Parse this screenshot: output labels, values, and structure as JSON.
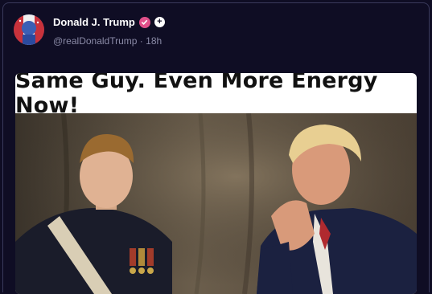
{
  "post": {
    "author_name": "Donald J. Trump",
    "handle": "@realDonaldTrump",
    "separator": "·",
    "time": "18h",
    "plus_symbol": "+",
    "verified_color": "#e0508a"
  },
  "media": {
    "headline": "Same Guy. Even More Energy Now!"
  },
  "icons": {
    "verified": "verified-check-icon",
    "follow": "plus-icon"
  }
}
